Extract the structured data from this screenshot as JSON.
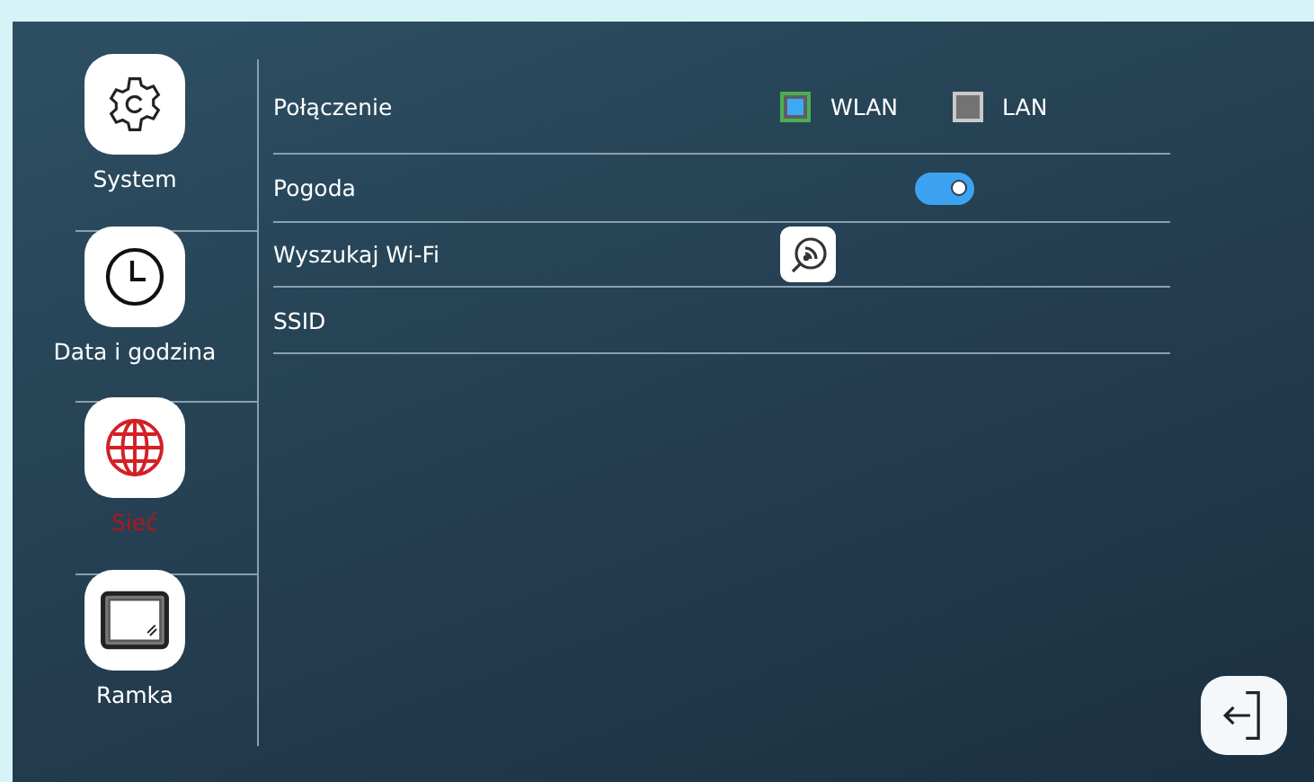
{
  "sidebar": {
    "items": [
      {
        "label": "System",
        "kind": "gear",
        "selected": false
      },
      {
        "label": "Data i godzina",
        "kind": "clock",
        "selected": false
      },
      {
        "label": "Sieć",
        "kind": "globe",
        "selected": true
      },
      {
        "label": "Ramka",
        "kind": "frame",
        "selected": false
      }
    ]
  },
  "settings": [
    {
      "kind": "options",
      "label": "Połączenie",
      "options": [
        {
          "label": "WLAN",
          "checked": true
        },
        {
          "label": "LAN",
          "checked": false
        }
      ]
    },
    {
      "kind": "toggle",
      "label": "Pogoda",
      "on": true
    },
    {
      "kind": "button",
      "label": "Wyszukaj Wi-Fi"
    },
    {
      "kind": "text",
      "label": "SSID"
    }
  ]
}
